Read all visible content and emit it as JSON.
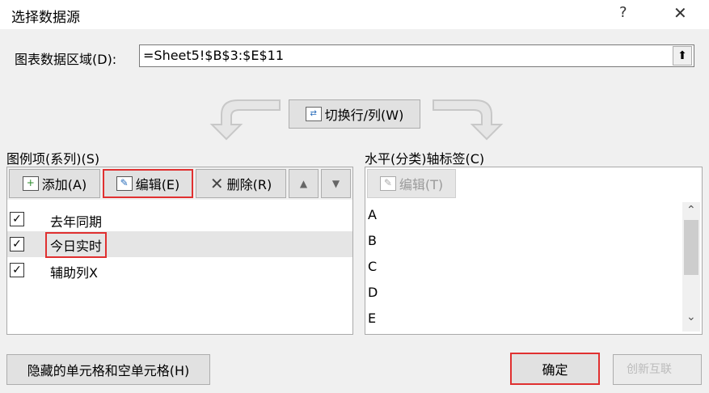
{
  "dialog": {
    "title": "选择数据源",
    "help": "?",
    "close": "✕"
  },
  "range": {
    "label": "图表数据区域(D):",
    "value": "=Sheet5!$B$3:$E$11",
    "collapse_icon": "⬆"
  },
  "switch_button": "切换行/列(W)",
  "series": {
    "heading": "图例项(系列)(S)",
    "add": "添加(A)",
    "edit": "编辑(E)",
    "delete": "删除(R)",
    "up": "▲",
    "down": "▼",
    "items": [
      {
        "label": "去年同期",
        "checked": "✓"
      },
      {
        "label": "今日实时",
        "checked": "✓"
      },
      {
        "label": "辅助列X",
        "checked": "✓"
      }
    ]
  },
  "axis": {
    "heading": "水平(分类)轴标签(C)",
    "edit": "编辑(T)",
    "items": [
      "A",
      "B",
      "C",
      "D",
      "E"
    ],
    "scroll_up": "⌃",
    "scroll_down": "⌄"
  },
  "footer": {
    "hidden_cells": "隐藏的单元格和空单元格(H)",
    "ok": "确定",
    "watermark": "创新互联"
  }
}
